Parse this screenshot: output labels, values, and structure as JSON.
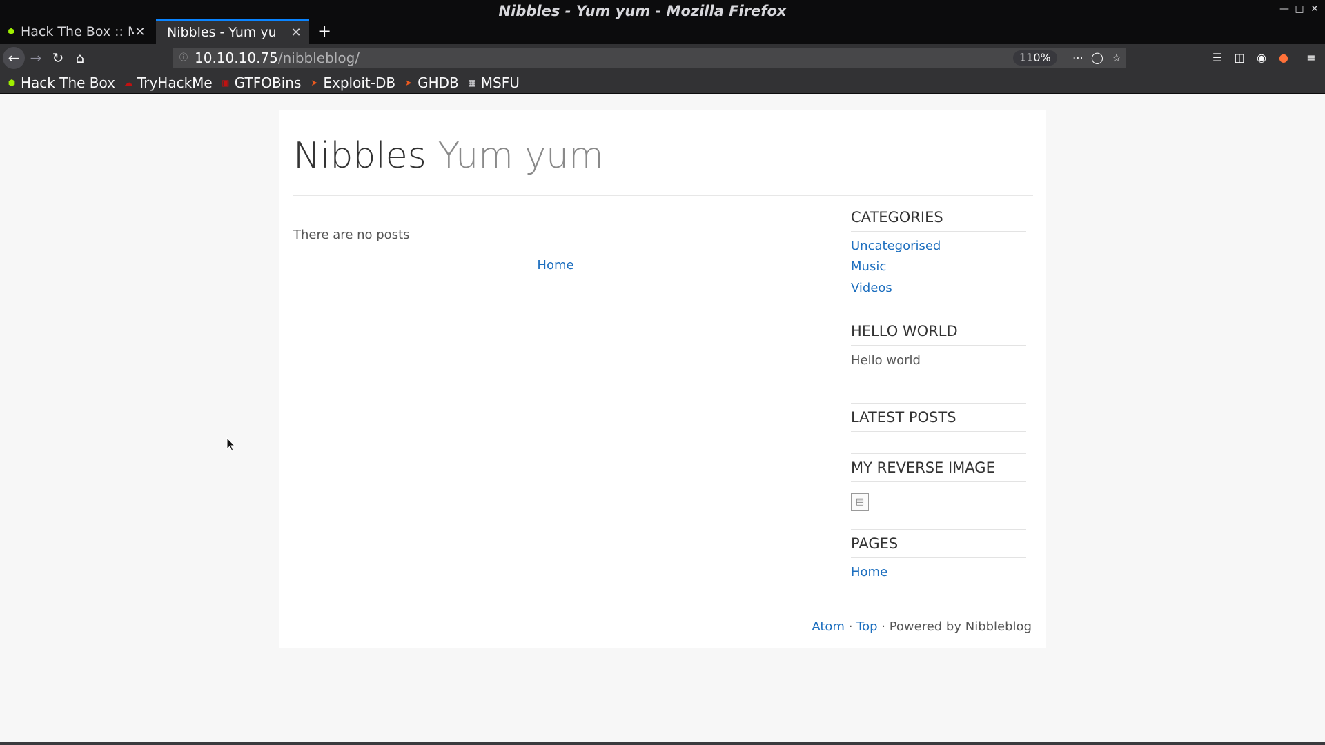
{
  "window": {
    "title": "Nibbles - Yum yum - Mozilla Firefox"
  },
  "tabs": [
    {
      "label": "Hack The Box :: M",
      "active": false,
      "favicon": "htb-cube-icon"
    },
    {
      "label": "Nibbles - Yum yu",
      "active": true,
      "favicon": "none"
    }
  ],
  "navbar": {
    "url_host": "10.10.10.75",
    "url_path": "/nibbleblog/",
    "zoom": "110%"
  },
  "bookmarks": [
    {
      "label": "Hack The Box",
      "icon": "htb-cube-icon",
      "color": "#9fef00"
    },
    {
      "label": "TryHackMe",
      "icon": "thm-icon",
      "color": "#c11111"
    },
    {
      "label": "GTFOBins",
      "icon": "gtfobins-icon",
      "color": "#c11111"
    },
    {
      "label": "Exploit-DB",
      "icon": "exploitdb-icon",
      "color": "#ec5a1f"
    },
    {
      "label": "GHDB",
      "icon": "ghdb-icon",
      "color": "#ec5a1f"
    },
    {
      "label": "MSFU",
      "icon": "msfu-icon",
      "color": "#d7d7db"
    }
  ],
  "site": {
    "name": "Nibbles",
    "slogan": "Yum yum",
    "no_posts": "There are no posts",
    "pager_home": "Home"
  },
  "sidebar": {
    "categories_title": "CATEGORIES",
    "categories": [
      "Uncategorised",
      "Music",
      "Videos"
    ],
    "hello_title": "HELLO WORLD",
    "hello_text": "Hello world",
    "latest_title": "LATEST POSTS",
    "image_title": "MY REVERSE IMAGE",
    "pages_title": "PAGES",
    "pages": [
      "Home"
    ]
  },
  "footer": {
    "atom": "Atom",
    "sep1": " · ",
    "top": "Top",
    "sep2": " · ",
    "powered": "Powered by Nibbleblog"
  },
  "colors": {
    "link": "#1d6fbf",
    "chrome_dark": "#0c0c0d",
    "chrome": "#323234",
    "accent": "#0a84ff"
  }
}
